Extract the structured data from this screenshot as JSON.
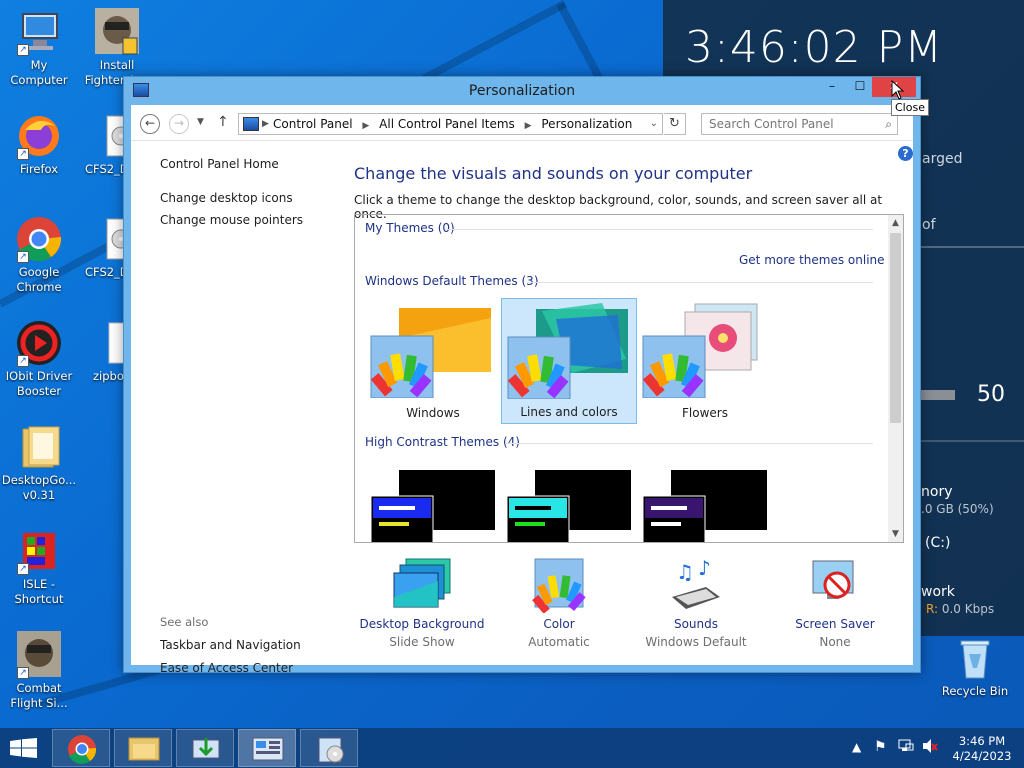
{
  "desktop": {
    "icons": [
      {
        "label": "My Computer"
      },
      {
        "label": "Install Fighter Ace"
      },
      {
        "label": "Firefox"
      },
      {
        "label": "CFS2_D"
      },
      {
        "label": "Google Chrome"
      },
      {
        "label": "CFS2_D"
      },
      {
        "label": "IObit Driver Booster"
      },
      {
        "label": "zipbo"
      },
      {
        "label": "DesktopGo... v0.31"
      },
      {
        "label": "ISLE - Shortcut"
      },
      {
        "label": "Combat Flight Si..."
      },
      {
        "label": "Recycle Bin"
      }
    ]
  },
  "widget": {
    "clock": "3:46:02 PM",
    "text1": "arged",
    "text2": "of",
    "volume": "50",
    "memory_label": "nory",
    "memory_value": ".0 GB (50%)",
    "drive_label": "(C:)",
    "network_label": "work",
    "network_value_prefix": "R:",
    "network_value": "0.0 Kbps"
  },
  "window": {
    "title": "Personalization",
    "controls": {
      "minimize": "–",
      "maximize": "☐",
      "close": "✕"
    },
    "tooltip": "Close",
    "address": {
      "crumbs": [
        "Control Panel",
        "All Control Panel Items",
        "Personalization"
      ],
      "search_placeholder": "Search Control Panel"
    },
    "left_links": [
      "Control Panel Home",
      "Change desktop icons",
      "Change mouse pointers"
    ],
    "see_also_label": "See also",
    "see_also": [
      "Taskbar and Navigation",
      "Ease of Access Center"
    ],
    "heading": "Change the visuals and sounds on your computer",
    "subheading": "Click a theme to change the desktop background, color, sounds, and screen saver all at once.",
    "groups": {
      "my": "My Themes (0)",
      "get_more": "Get more themes online",
      "default": "Windows Default Themes (3)",
      "high_contrast": "High Contrast Themes (4)"
    },
    "default_themes": [
      {
        "label": "Windows",
        "selected": false
      },
      {
        "label": "Lines and colors",
        "selected": true
      },
      {
        "label": "Flowers",
        "selected": false
      }
    ],
    "bottom": [
      {
        "title": "Desktop Background",
        "value": "Slide Show"
      },
      {
        "title": "Color",
        "value": "Automatic"
      },
      {
        "title": "Sounds",
        "value": "Windows Default"
      },
      {
        "title": "Screen Saver",
        "value": "None"
      }
    ]
  },
  "taskbar": {
    "time": "3:46 PM",
    "date": "4/24/2023"
  },
  "colors": {
    "accent": "#1e3287",
    "close_red": "#e04343",
    "selection": "#cce6fb"
  }
}
